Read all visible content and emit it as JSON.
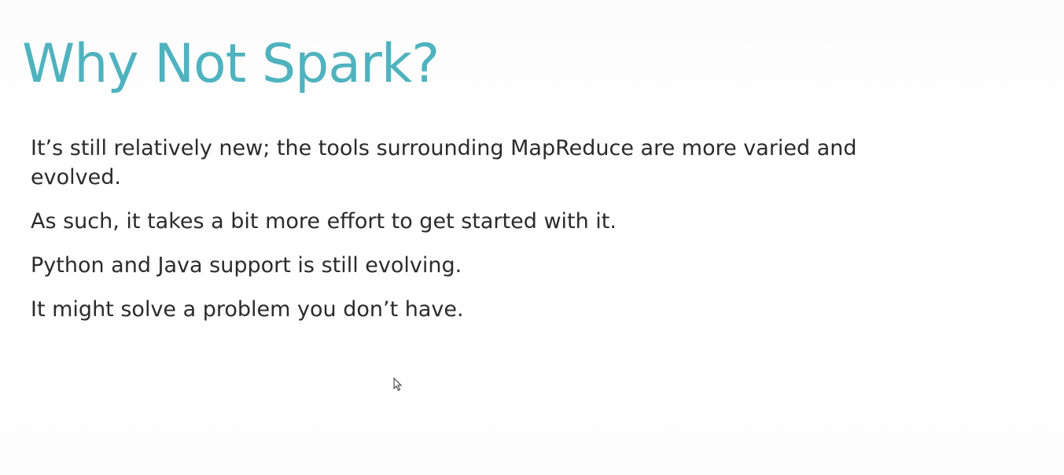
{
  "slide": {
    "title": "Why Not Spark?",
    "title_color": "#4fb3bf",
    "bullets": [
      "It’s still relatively new; the tools surrounding MapReduce are more varied and evolved.",
      "As such, it takes a bit more effort to get started with it.",
      "Python and Java support is still evolving.",
      "It might solve a problem you don’t have."
    ]
  },
  "cursor": {
    "icon": "mouse-pointer-icon"
  }
}
